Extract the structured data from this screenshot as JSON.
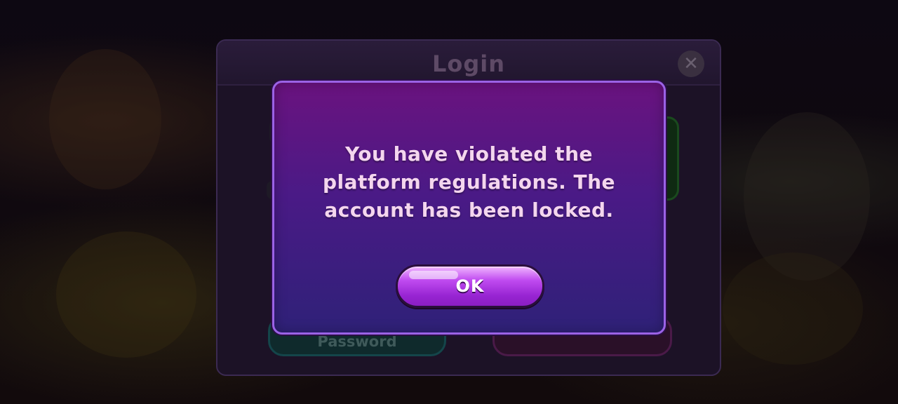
{
  "login_panel": {
    "title": "Login",
    "close_icon": "close-icon",
    "password_button_label": "Password"
  },
  "alert": {
    "message": "You have violated the platform regulations. The account has been locked.",
    "ok_label": "OK"
  },
  "colors": {
    "dialog_border": "#9b62e6",
    "dialog_top": "#6a137f",
    "dialog_bottom": "#2f2178",
    "message_text": "#f4d6ee",
    "ok_button": "#b33de6"
  }
}
